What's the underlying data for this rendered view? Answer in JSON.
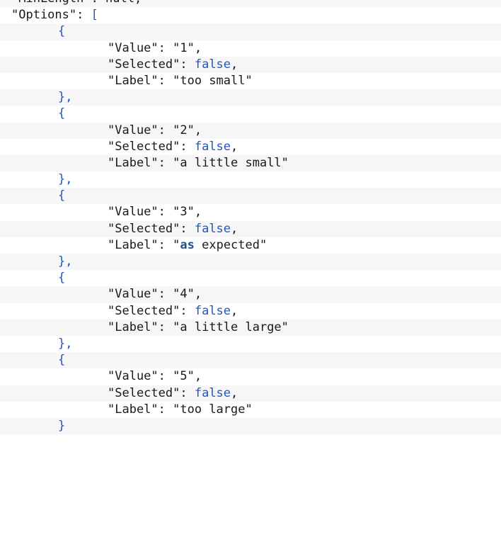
{
  "editor": {
    "top_partial_line": "\"MinLength\": null,",
    "options_key": "\"Options\"",
    "options_open": "[",
    "obj_open": "{",
    "obj_close": "},",
    "last_close": "}",
    "colon": ": ",
    "comma": ",",
    "value_key": "\"Value\"",
    "selected_key": "\"Selected\"",
    "label_key": "\"Label\"",
    "false_literal": "false",
    "options": [
      {
        "value": "\"1\"",
        "label": "\"too small\""
      },
      {
        "value": "\"2\"",
        "label": "\"a little small\""
      },
      {
        "value": "\"3\"",
        "label_prefix": "\"",
        "label_highlight": "as",
        "label_suffix": " expected\""
      },
      {
        "value": "\"4\"",
        "label": "\"a little large\""
      },
      {
        "value": "\"5\"",
        "label": "\"too large\""
      }
    ]
  },
  "colors": {
    "keyword": "#1f55c9",
    "text": "#1a1a1a",
    "stripe": "#f6f6f6",
    "background": "#ffffff"
  }
}
